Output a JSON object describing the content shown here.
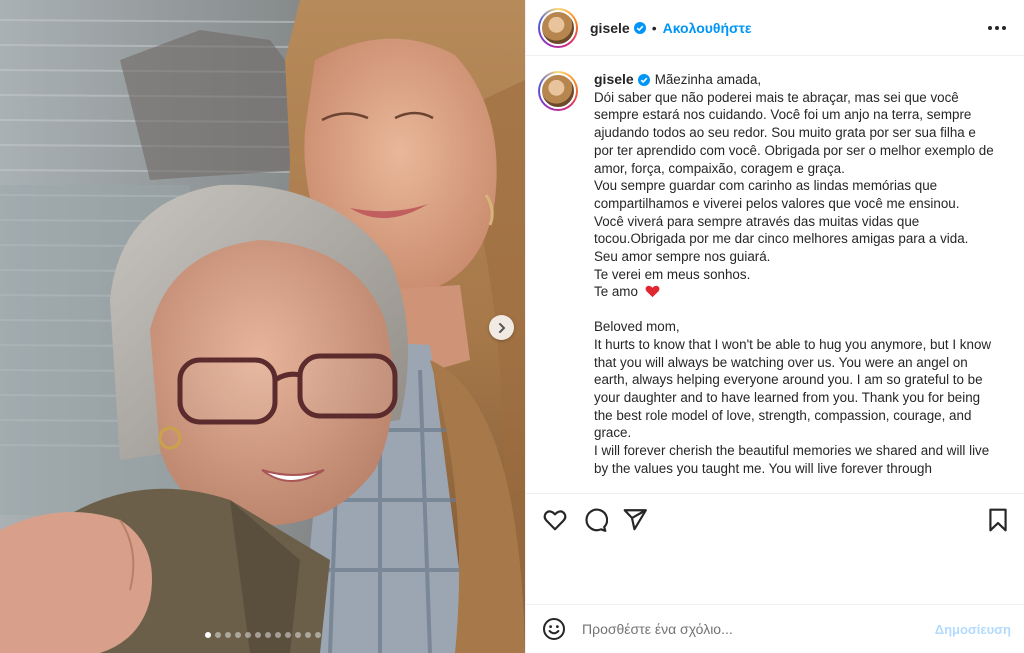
{
  "post": {
    "username": "gisele",
    "follow_label": "Ακολουθήστε",
    "bullet": "•",
    "carousel": {
      "slide_count": 12,
      "active_index": 0
    }
  },
  "caption": {
    "username": "gisele",
    "pt_first": "Mãezinha amada,",
    "pt_lines": [
      "Dói saber que não poderei mais te abraçar, mas sei que você sempre estará nos cuidando. Você foi um anjo na terra, sempre ajudando todos ao seu redor. Sou muito grata por ser sua filha e por ter aprendido com você. Obrigada por ser o melhor exemplo de amor, força, compaixão, coragem e graça.",
      "Vou sempre guardar com carinho as lindas memórias que compartilhamos e viverei pelos valores que você me ensinou.",
      "Você viverá para sempre através das muitas vidas que tocou.Obrigada por me dar cinco melhores amigas para a vida.",
      "Seu amor sempre nos guiará.",
      "Te verei em meus sonhos."
    ],
    "pt_last": "Te amo",
    "en_first": "Beloved mom,",
    "en_lines": [
      "It hurts to know that I won't be able to hug you anymore, but I know that you will always be watching over us. You were an angel on earth, always helping everyone around you. I am so grateful to be your daughter and to have learned from you. Thank you for being the best role model of love, strength, compassion, courage, and grace.",
      "I will forever cherish the beautiful memories we shared and will live by the values you taught me. You will live forever through"
    ]
  },
  "comment": {
    "placeholder": "Προσθέστε ένα σχόλιο...",
    "post_label": "Δημοσίευση"
  },
  "colors": {
    "link": "#0095f6",
    "verified": "#0095f6",
    "heart": "#e0262f",
    "post_disabled": "#b3dbff"
  },
  "icons": [
    "verified-badge-icon",
    "more-options-icon",
    "like-icon",
    "comment-icon",
    "share-icon",
    "save-icon",
    "emoji-icon",
    "chevron-right-icon",
    "heart-emoji-icon"
  ]
}
